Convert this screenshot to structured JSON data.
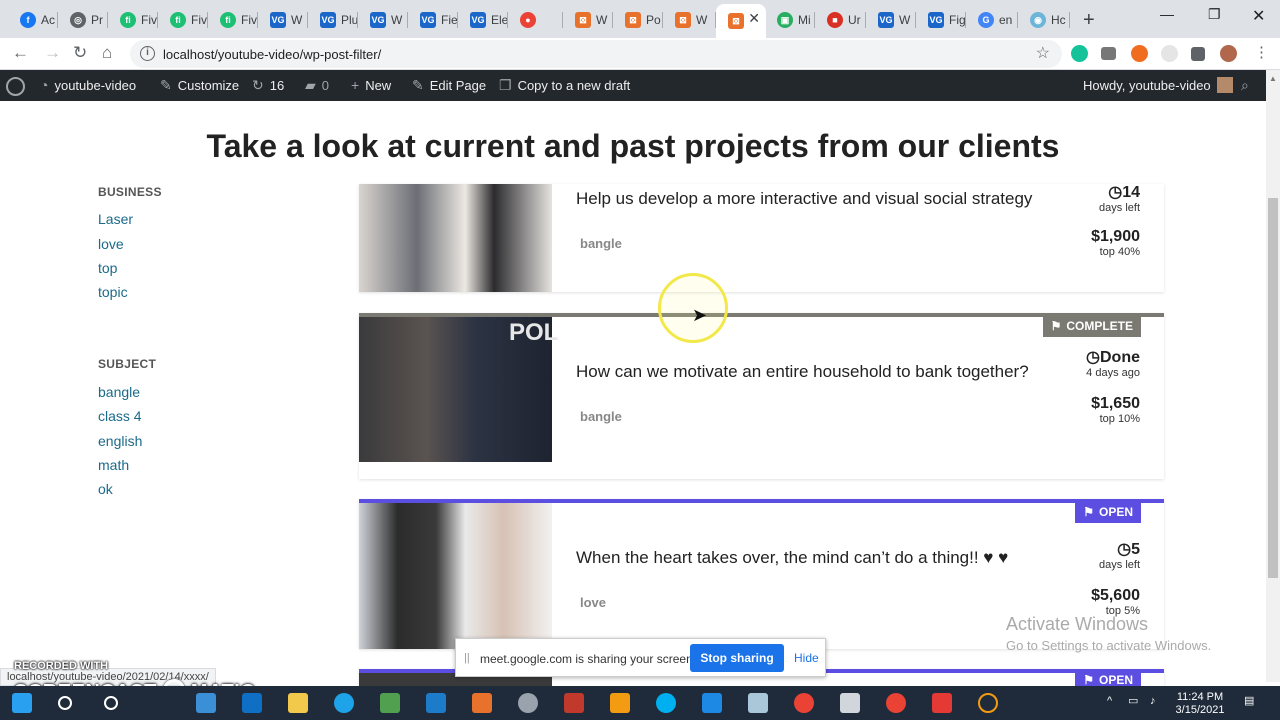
{
  "browser": {
    "tabs": [
      {
        "label": "Ac",
        "fav_color": "#1877f2",
        "fav_glyph": "f"
      },
      {
        "label": "Pr",
        "fav_color": "#5f6368",
        "fav_glyph": "◎"
      },
      {
        "label": "Fiv",
        "fav_color": "#1dbf73",
        "fav_glyph": "fi"
      },
      {
        "label": "Fiv",
        "fav_color": "#1dbf73",
        "fav_glyph": "fi"
      },
      {
        "label": "Fiv",
        "fav_color": "#1dbf73",
        "fav_glyph": "fi"
      },
      {
        "label": "W",
        "fav_color": "#1b67c9",
        "fav_glyph": "VG"
      },
      {
        "label": "Plu",
        "fav_color": "#1b67c9",
        "fav_glyph": "VG"
      },
      {
        "label": "W",
        "fav_color": "#1b67c9",
        "fav_glyph": "VG"
      },
      {
        "label": "Fie",
        "fav_color": "#1b67c9",
        "fav_glyph": "VG"
      },
      {
        "label": "Ele",
        "fav_color": "#1b67c9",
        "fav_glyph": "VG"
      },
      {
        "label": "",
        "fav_color": "#ea4335",
        "fav_glyph": "●"
      },
      {
        "label": "W",
        "fav_color": "#e8712c",
        "fav_glyph": "⊠"
      },
      {
        "label": "Po",
        "fav_color": "#e8712c",
        "fav_glyph": "⊠"
      },
      {
        "label": "W",
        "fav_color": "#e8712c",
        "fav_glyph": "⊠"
      },
      {
        "label": "",
        "fav_color": "#e8712c",
        "fav_glyph": "⊠"
      },
      {
        "label": "Mi",
        "fav_color": "#27ae60",
        "fav_glyph": "▣"
      },
      {
        "label": "Ur",
        "fav_color": "#d93025",
        "fav_glyph": "■"
      },
      {
        "label": "W",
        "fav_color": "#1b67c9",
        "fav_glyph": "VG"
      },
      {
        "label": "Fig",
        "fav_color": "#1b67c9",
        "fav_glyph": "VG"
      },
      {
        "label": "en",
        "fav_color": "#4285f4",
        "fav_glyph": "G"
      },
      {
        "label": "Hc",
        "fav_color": "#6cb4d8",
        "fav_glyph": "◉"
      }
    ],
    "address": "localhost/youtube-video/wp-post-filter/",
    "status_url": "localhost/youtube-video/2021/02/14/xxxx/"
  },
  "adminbar": {
    "site": "youtube-video",
    "customize": "Customize",
    "updates": "16",
    "comments": "0",
    "new": "New",
    "edit": "Edit Page",
    "copy": "Copy to a new draft",
    "howdy": "Howdy, youtube-video"
  },
  "page": {
    "heading": "Take a look at current and past projects from our clients"
  },
  "sidebar": {
    "business_heading": "BUSINESS",
    "business": [
      "Laser",
      "love",
      "top",
      "topic"
    ],
    "subject_heading": "SUBJECT",
    "subject": [
      "bangle",
      "class 4",
      "english",
      "math",
      "ok"
    ]
  },
  "projects": [
    {
      "title": "Help us develop a more interactive and visual social strategy",
      "tag": "bangle",
      "time": "14",
      "time_label": "days left",
      "amount": "$1,900",
      "pct": "top 40%",
      "badge": "",
      "accent": ""
    },
    {
      "title": "How can we motivate an entire household to bank together?",
      "tag": "bangle",
      "time": "Done",
      "time_label": "4 days ago",
      "amount": "$1,650",
      "pct": "top 10%",
      "badge": "COMPLETE",
      "accent": "#7a7a72"
    },
    {
      "title": "When the heart takes over, the mind can’t do a thing!! ♥ ♥",
      "tag": "love",
      "time": "5",
      "time_label": "days left",
      "amount": "$5,600",
      "pct": "top 5%",
      "badge": "OPEN",
      "accent": "#5b4ee0"
    },
    {
      "badge": "OPEN",
      "accent": "#5b4ee0"
    }
  ],
  "share_bar": {
    "message": "meet.google.com is sharing your screen.",
    "stop": "Stop sharing",
    "hide": "Hide"
  },
  "watermark": {
    "line1": "Activate Windows",
    "line2": "Go to Settings to activate Windows."
  },
  "recorder": {
    "line1": "RECORDED WITH",
    "line2": "SCREENCAST",
    "line3": "MATIC"
  },
  "taskbar": {
    "time": "11:24 PM",
    "date": "3/15/2021"
  }
}
